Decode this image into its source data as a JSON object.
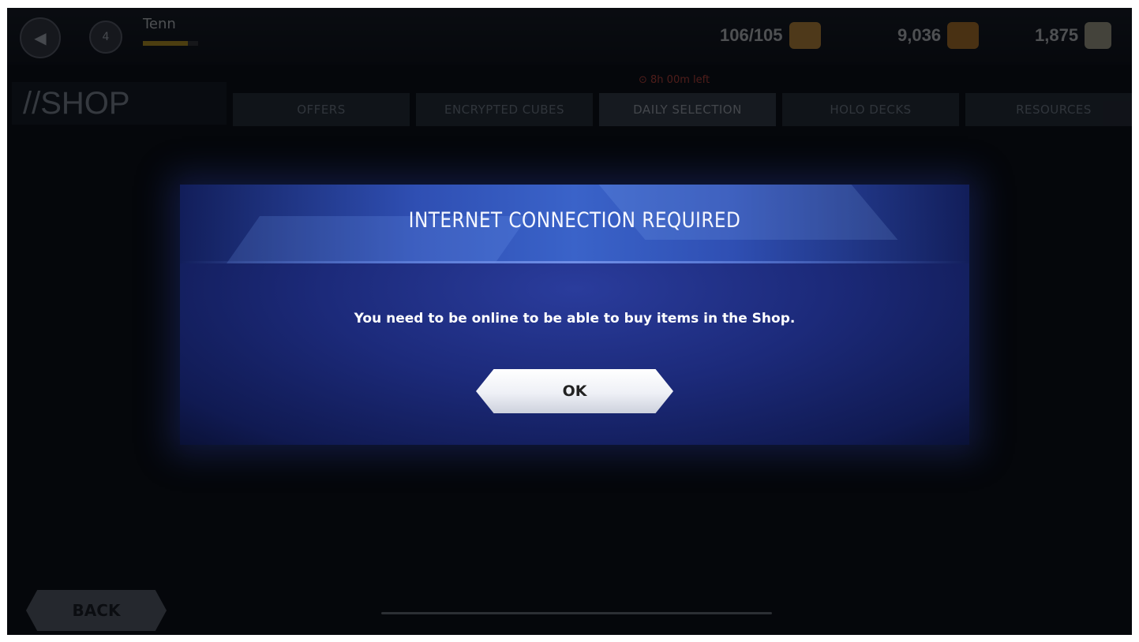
{
  "header": {
    "player_name": "Tenn",
    "xp_progress": 0.82,
    "level": "4",
    "currencies": [
      {
        "name": "energy",
        "value": "106/105",
        "color": "#e7a23a"
      },
      {
        "name": "gold",
        "value": "9,036",
        "color": "#d98a26"
      },
      {
        "name": "crystals",
        "value": "1,875",
        "color": "#c8c1a0"
      }
    ]
  },
  "shop": {
    "title": "//SHOP",
    "timer": "⊙ 8h 00m left",
    "tabs": [
      "OFFERS",
      "ENCRYPTED CUBES",
      "DAILY SELECTION",
      "HOLO DECKS",
      "RESOURCES"
    ]
  },
  "back_label": "BACK",
  "dialog": {
    "title": "INTERNET CONNECTION REQUIRED",
    "message": "You need to be online to be able to buy items in the Shop.",
    "ok_label": "OK"
  },
  "colors": {
    "dialog_bg": "#1c2a7a",
    "dialog_header": "#3a63c9",
    "accent_red": "#e94b3c"
  },
  "icons": [
    "back-arrow-icon",
    "level-badge-icon",
    "energy-icon",
    "gold-icon",
    "crystal-icon"
  ]
}
